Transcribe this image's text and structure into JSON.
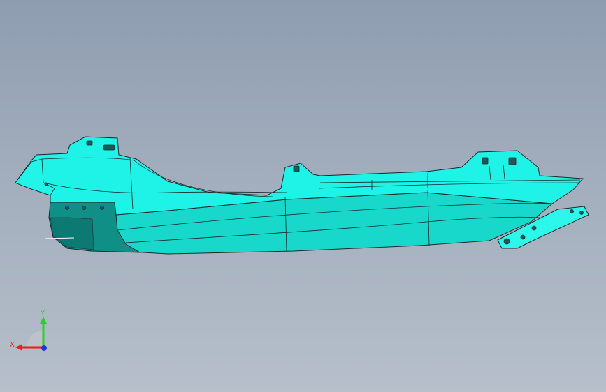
{
  "viewport": {
    "model_fill": "#1ff2e6",
    "model_shade": "#16c6bd",
    "model_dark": "#0f8f86",
    "edge_color": "#1a2a2a"
  },
  "triad": {
    "x_label": "X",
    "y_label": "Y",
    "x_color": "#e8201a",
    "y_color": "#2ad02a",
    "z_color": "#1d35e0"
  }
}
